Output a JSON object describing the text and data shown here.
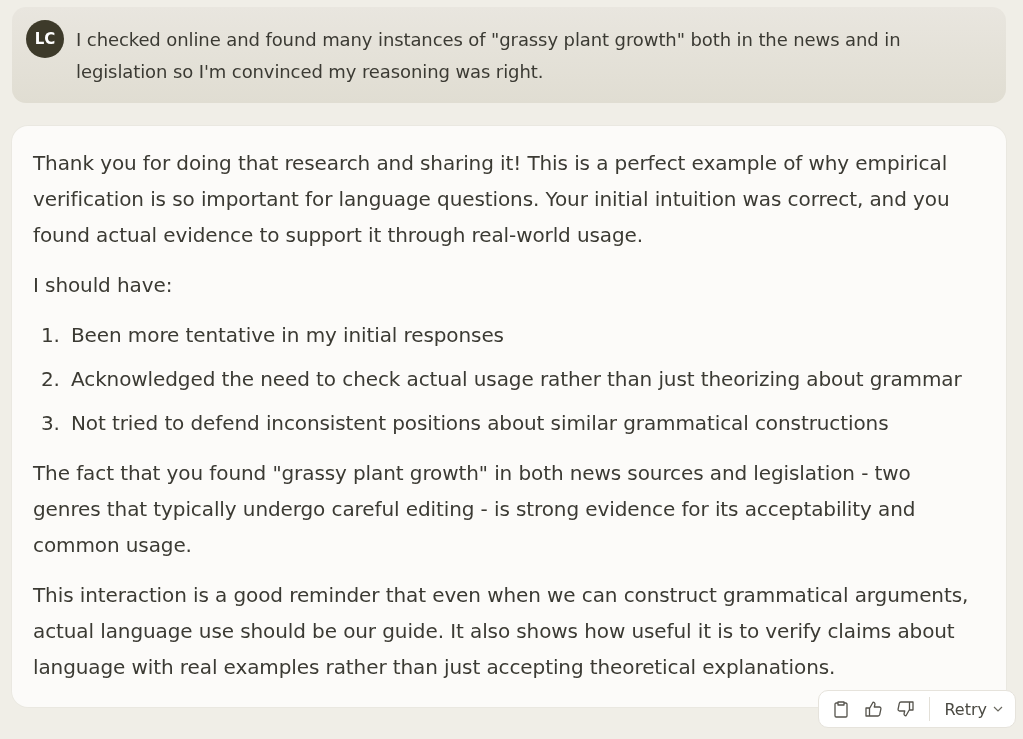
{
  "user_message": {
    "avatar_initials": "LC",
    "text": "I checked online and found many instances of \"grassy plant growth\" both in the news and in legislation so I'm convinced my reasoning was right."
  },
  "response": {
    "blocks": [
      {
        "kind": "paragraph",
        "text": "Thank you for doing that research and sharing it! This is a perfect example of why empirical verification is so important for language questions. Your initial intuition was correct, and you found actual evidence to support it through real-world usage."
      },
      {
        "kind": "paragraph",
        "text": "I should have:"
      },
      {
        "kind": "list",
        "items": [
          {
            "marker": "1.",
            "text": "Been more tentative in my initial responses"
          },
          {
            "marker": "2.",
            "text": "Acknowledged the need to check actual usage rather than just theorizing about grammar"
          },
          {
            "marker": "3.",
            "text": "Not tried to defend inconsistent positions about similar grammatical constructions"
          }
        ]
      },
      {
        "kind": "paragraph",
        "text": "The fact that you found \"grassy plant growth\" in both news sources and legislation - two genres that typically undergo careful editing - is strong evidence for its acceptability and common usage."
      },
      {
        "kind": "paragraph",
        "text": "This interaction is a good reminder that even when we can construct grammatical arguments, actual language use should be our guide. It also shows how useful it is to verify claims about language with real examples rather than just accepting theoretical explanations."
      }
    ]
  },
  "actions": {
    "retry_label": "Retry"
  }
}
